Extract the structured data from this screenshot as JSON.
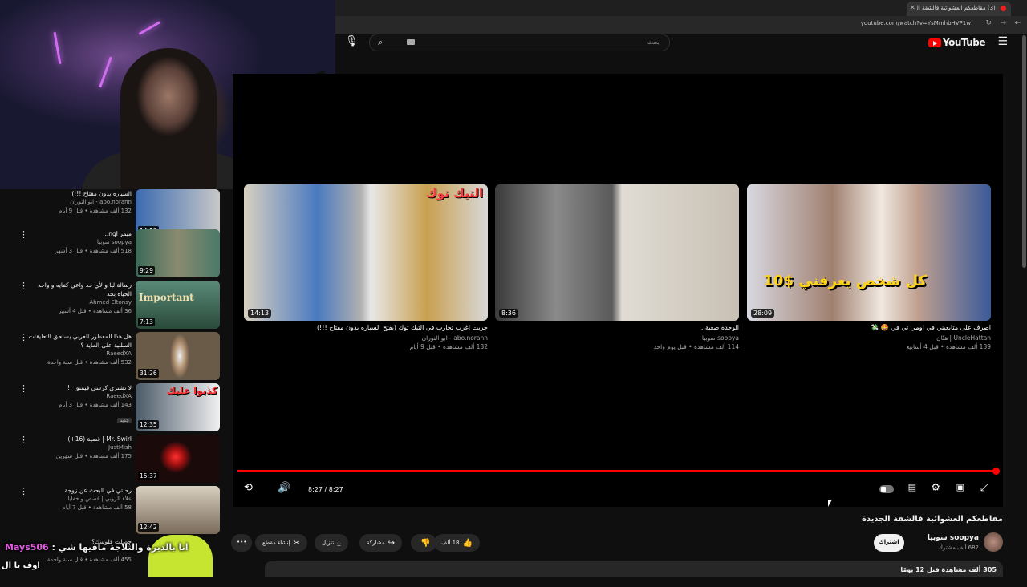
{
  "browser": {
    "tab_title": "(3) مقاطعكم العشوائية فالشقة ال",
    "url": "youtube.com/watch?v=YsMmhbHVP1w"
  },
  "header": {
    "logo": "YouTube",
    "search_placeholder": "بحث"
  },
  "player": {
    "time": "8:27 / 8:27",
    "progress": 1.0,
    "end_cards": [
      {
        "title": "اصرف على متابعيني في اومي تي في 🤩 💸",
        "channel": "UncleHattan | هتّان",
        "meta": "139 ألف مشاهدة • قبل 4 أسابيع",
        "duration": "28:09",
        "overlay_text": "كل شخص يعرفني $10"
      },
      {
        "title": "الوحدة صعبة...",
        "channel": "soopya سوبيا",
        "meta": "114 ألف مشاهدة • قبل يوم واحد",
        "duration": "8:36",
        "overlay_text": ""
      },
      {
        "title": "جربت اغرب تجارب في التيك توك (بفتح السياره بدون مفتاح !!!)",
        "channel": "abo.norann - ابو النوران",
        "meta": "132 ألف مشاهدة • قبل 9 أيام",
        "duration": "14:13",
        "overlay_text": "التيك توك"
      }
    ]
  },
  "video": {
    "title": "مقاطعكم العشوائية فالشقة الجديدة",
    "channel": "soopya سوبيا",
    "subscribers": "682 ألف مشترك",
    "subscribe_label": "اشتراك",
    "likes": "18 ألف",
    "share_label": "مشاركة",
    "download_label": "تنزيل",
    "clip_label": "إنشاء مقطع",
    "description_meta": "305 ألف مشاهدة  قبل 12 يومًا"
  },
  "sidebar": [
    {
      "title": "السياره بدون مفتاح !!!)",
      "channel": "abo.norann - ابو النوران",
      "meta": "132 ألف مشاهدة • قبل 9 أيام",
      "duration": "14:13",
      "color": "#8fa0b8"
    },
    {
      "title": "ميمز ngl...",
      "channel": "soopya سوبيا",
      "meta": "518 ألف مشاهدة • قبل 3 أشهر",
      "duration": "9:29",
      "color": "#4a7a68"
    },
    {
      "title": "رسالة ليا و لأي حد واعي كفايه و واخد الحياه بجد",
      "channel": "Ahmed Eltonsy",
      "meta": "36 ألف مشاهدة • قبل 4 أشهر",
      "duration": "7:13",
      "color": "#3a5a4a",
      "overlay_text": "Important"
    },
    {
      "title": "هل هذا المعطور العربي يستحق التعليقات السلبية على الماية ؟",
      "channel": "RaeedXA",
      "meta": "532 ألف مشاهدة • قبل سنة واحدة",
      "duration": "31:26",
      "color": "#6a5a48"
    },
    {
      "title": "لا تشتري كرسي قيمنق !!",
      "channel": "RaeedXA",
      "meta": "143 ألف مشاهدة • قبل 3 أيام",
      "duration": "12:35",
      "color": "#2a3a48",
      "badge": "جديد",
      "overlay_text": "كذبوا عليك"
    },
    {
      "title": "Mr. Swirl | قصية (16+)",
      "channel": "JustMish",
      "meta": "175 ألف مشاهدة • قبل شهرين",
      "duration": "15:37",
      "color": "#1a0a0a"
    },
    {
      "title": "رحلتي في البحث عن زوجة",
      "channel": "علاء الروبي | قصص و خفايا",
      "meta": "58 ألف مشاهدة • قبل 7 أيام",
      "duration": "12:42",
      "color": "#6a5a4a"
    },
    {
      "title": "حصلت فلوسك؟",
      "channel": "",
      "meta": "455 ألف مشاهدة • قبل سنة واحدة",
      "duration": "",
      "color": "#3a3a2a"
    }
  ],
  "chat": {
    "user": "Mays506",
    "message": "انا بالديرة والثلاجة مافيها شي",
    "line2": "اوف يا ال"
  },
  "colors": {
    "accent": "#ff0000",
    "background": "#0f0f0f",
    "neon": "#d06cf0"
  }
}
